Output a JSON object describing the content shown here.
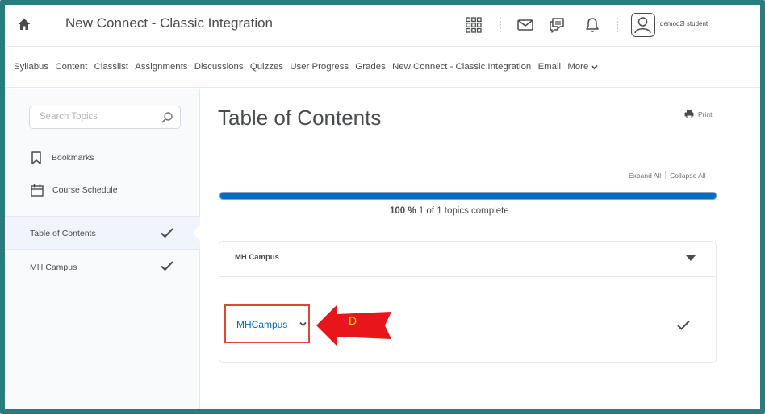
{
  "header": {
    "course_title": "New Connect - Classic Integration",
    "username": "demod2l student",
    "icons": [
      "home-icon",
      "apps-grid-icon",
      "mail-icon",
      "chat-icon",
      "bell-icon",
      "user-avatar-icon"
    ]
  },
  "nav": {
    "items": [
      "Syllabus",
      "Content",
      "Classlist",
      "Assignments",
      "Discussions",
      "Quizzes",
      "User Progress",
      "Grades",
      "New Connect - Classic Integration",
      "Email"
    ],
    "more_label": "More"
  },
  "sidebar": {
    "search_placeholder": "Search Topics",
    "bookmarks_label": "Bookmarks",
    "schedule_label": "Course Schedule",
    "toc_label": "Table of Contents",
    "module_label": "MH Campus"
  },
  "main": {
    "title": "Table of Contents",
    "print_label": "Print",
    "expand_all": "Expand All",
    "collapse_all": "Collapse All",
    "progress_percent": 100,
    "progress_percent_label": "100 %",
    "progress_detail": "1 of 1 topics complete",
    "module_title": "MH Campus",
    "topic_link": "MHCampus",
    "annotation_letter": "D"
  },
  "colors": {
    "frame": "#2c7a7e",
    "link": "#006fbf",
    "progress": "#006fbf",
    "highlight_box": "#e0453d",
    "arrow": "#e8151b",
    "arrow_label": "#f5d21d"
  }
}
